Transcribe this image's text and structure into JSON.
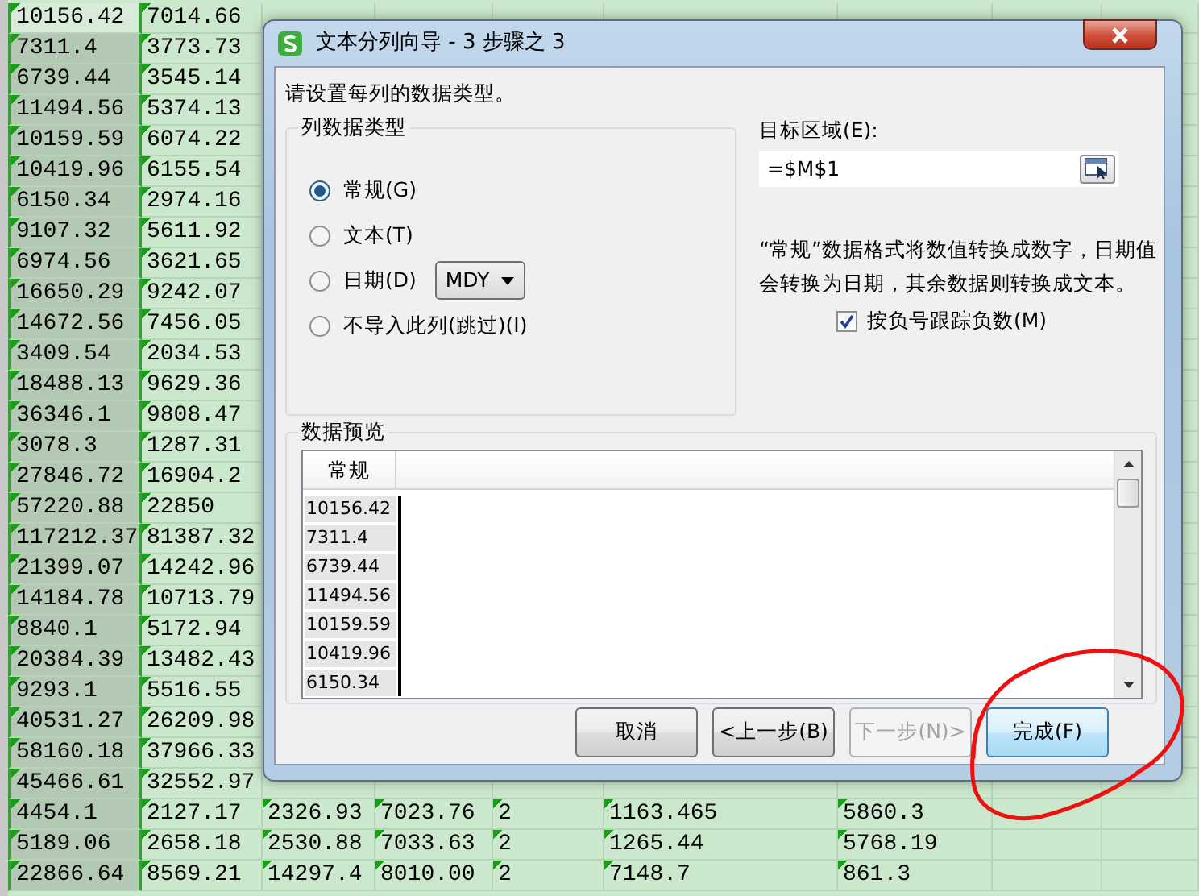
{
  "sheet": {
    "columns": [
      {
        "selected": true
      },
      {
        "selected": false
      },
      {
        "selected": false
      },
      {
        "selected": false
      },
      {
        "selected": false
      },
      {
        "selected": false
      },
      {
        "selected": false
      },
      {
        "selected": false
      },
      {
        "selected": false
      }
    ],
    "rows": [
      [
        "10156.42",
        "7014.66"
      ],
      [
        "7311.4",
        "3773.73"
      ],
      [
        "6739.44",
        "3545.14"
      ],
      [
        "11494.56",
        "5374.13"
      ],
      [
        "10159.59",
        "6074.22"
      ],
      [
        "10419.96",
        "6155.54"
      ],
      [
        "6150.34",
        "2974.16"
      ],
      [
        "9107.32",
        "5611.92"
      ],
      [
        "6974.56",
        "3621.65"
      ],
      [
        "16650.29",
        "9242.07"
      ],
      [
        "14672.56",
        "7456.05"
      ],
      [
        "3409.54",
        "2034.53"
      ],
      [
        "18488.13",
        "9629.36"
      ],
      [
        "36346.1",
        "9808.47"
      ],
      [
        "3078.3",
        "1287.31"
      ],
      [
        "27846.72",
        "16904.2"
      ],
      [
        "57220.88",
        "22850"
      ],
      [
        "117212.37",
        "81387.32"
      ],
      [
        "21399.07",
        "14242.96"
      ],
      [
        "14184.78",
        "10713.79"
      ],
      [
        "8840.1",
        "5172.94"
      ],
      [
        "20384.39",
        "13482.43"
      ],
      [
        "9293.1",
        "5516.55"
      ],
      [
        "40531.27",
        "26209.98"
      ],
      [
        "58160.18",
        "37966.33"
      ],
      [
        "45466.61",
        "32552.97"
      ],
      [
        "4454.1",
        "2127.17",
        "2326.93",
        "7023.76",
        "2",
        "1163.465",
        "5860.3"
      ],
      [
        "5189.06",
        "2658.18",
        "2530.88",
        "7033.63",
        "2",
        "1265.44",
        "5768.19"
      ],
      [
        "22866.64",
        "8569.21",
        "14297.4",
        "8010.00",
        "2",
        "7148.7",
        "861.3"
      ]
    ]
  },
  "dialog": {
    "title": "文本分列向导 - 3 步骤之 3",
    "prompt": "请设置每列的数据类型。",
    "column_type": {
      "legend": "列数据类型",
      "options": [
        {
          "kind": "plain",
          "label": "常规(G)",
          "selected": true
        },
        {
          "kind": "plain",
          "label": "文本(T)",
          "selected": false
        },
        {
          "kind": "date",
          "label": "日期(D)",
          "selected": false,
          "date_format": "MDY"
        },
        {
          "kind": "plain",
          "label": "不导入此列(跳过)(I)",
          "selected": false
        }
      ]
    },
    "destination": {
      "label": "目标区域(E):",
      "value": "=$M$1"
    },
    "description": "“常规”数据格式将数值转换成数字，日期值会转换为日期，其余数据则转换成文本。",
    "negative_option": {
      "label": "按负号跟踪负数(M)",
      "checked": true
    },
    "preview": {
      "legend": "数据预览",
      "header": "常规",
      "values": [
        "10156.42",
        "7311.4",
        "6739.44",
        "11494.56",
        "10159.59",
        "10419.96",
        "6150.34"
      ]
    },
    "buttons": [
      {
        "label": "取消",
        "disabled": false,
        "default": false
      },
      {
        "label": "<上一步(B)",
        "disabled": false,
        "default": false
      },
      {
        "label": "下一步(N)>",
        "disabled": true,
        "default": false
      },
      {
        "label": "完成(F)",
        "disabled": false,
        "default": true
      }
    ]
  }
}
